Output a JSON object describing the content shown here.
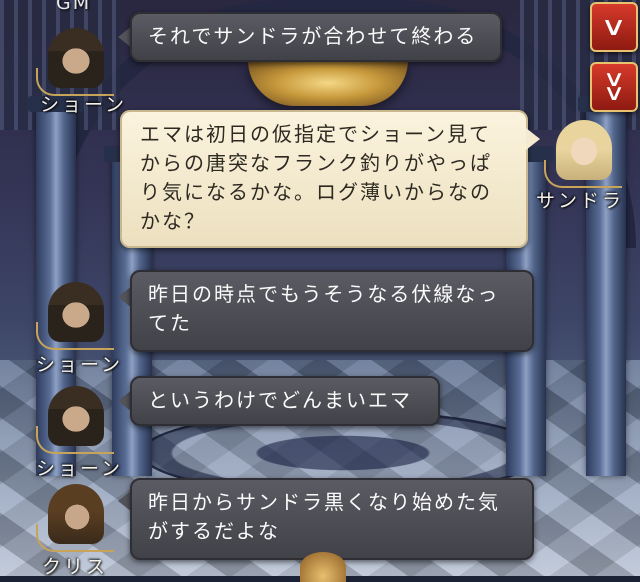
{
  "header": {
    "gm_label": "GM"
  },
  "controls": {
    "scroll_up_icon": "chevron-down",
    "scroll_down_icon": "double-chevron-down"
  },
  "messages": [
    {
      "speaker": "ショーン",
      "side": "left",
      "style": "dark",
      "lines": [
        "それでサンドラが合わせて終わる"
      ]
    },
    {
      "speaker": "サンドラ",
      "side": "right",
      "style": "light",
      "lines": [
        "エマは初日の仮指定でショーン見て",
        "からの唐突なフランク釣りがやっぱ",
        "り気になるかな。ログ薄いからなの",
        "かな？"
      ]
    },
    {
      "speaker": "ショーン",
      "side": "left",
      "style": "dark",
      "lines": [
        "昨日の時点でもうそうなる伏線なっ",
        "てた"
      ]
    },
    {
      "speaker": "ショーン",
      "side": "left",
      "style": "dark",
      "lines": [
        "というわけでどんまいエマ"
      ]
    },
    {
      "speaker": "クリス",
      "side": "left",
      "style": "dark",
      "lines": [
        "昨日からサンドラ黒くなり始めた気",
        "がするだよな"
      ]
    }
  ],
  "colors": {
    "dark_bubble": "#4b4b52",
    "light_bubble": "#f4ead0",
    "button_red": "#c0281c",
    "button_gold": "#e7c36f"
  }
}
